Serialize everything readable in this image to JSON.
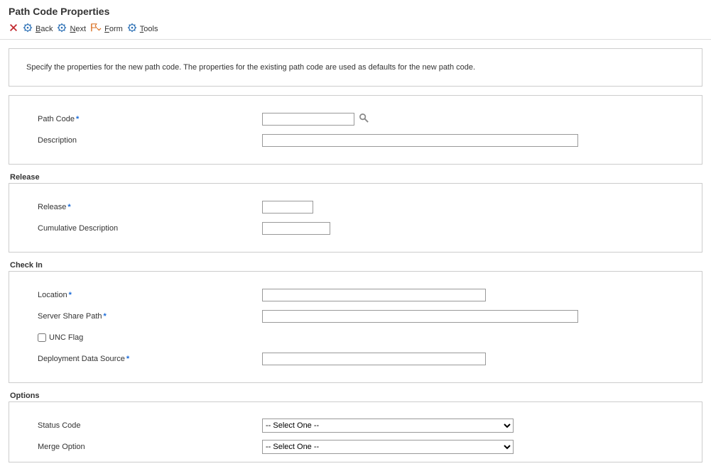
{
  "title": "Path Code Properties",
  "toolbar": {
    "back": {
      "pre": "",
      "u": "B",
      "post": "ack"
    },
    "next": {
      "pre": "",
      "u": "N",
      "post": "ext"
    },
    "form": {
      "pre": "",
      "u": "F",
      "post": "orm"
    },
    "tools": {
      "pre": "",
      "u": "T",
      "post": "ools"
    }
  },
  "intro": "Specify the properties for the new path code. The properties for the existing path code are used as defaults for the new path code.",
  "sections": {
    "top": {
      "path_code_label": "Path Code",
      "path_code_value": "",
      "description_label": "Description",
      "description_value": ""
    },
    "release": {
      "title": "Release",
      "release_label": "Release",
      "release_value": "",
      "cum_desc_label": "Cumulative Description",
      "cum_desc_value": ""
    },
    "checkin": {
      "title": "Check In",
      "location_label": "Location",
      "location_value": "",
      "share_label": "Server Share Path",
      "share_value": "",
      "unc_label": "UNC Flag",
      "unc_checked": false,
      "deploy_label": "Deployment Data Source",
      "deploy_value": ""
    },
    "options": {
      "title": "Options",
      "status_label": "Status Code",
      "status_placeholder": "-- Select One --",
      "merge_label": "Merge Option",
      "merge_placeholder": "-- Select One --"
    }
  }
}
